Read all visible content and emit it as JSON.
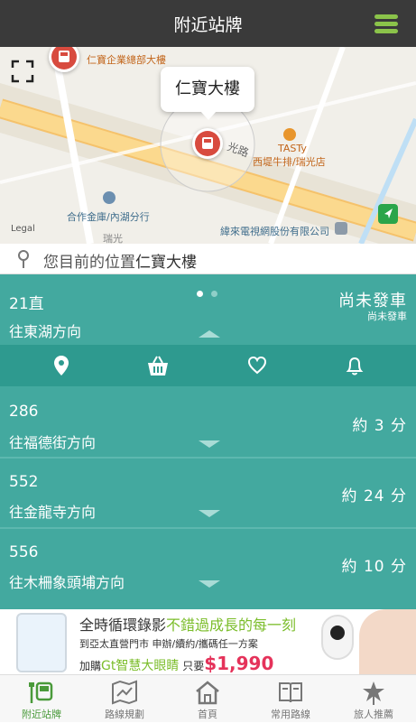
{
  "header": {
    "title": "附近站牌"
  },
  "map": {
    "labels": {
      "company": "仁寶企業總部大樓",
      "road": "光路",
      "restaurant_brand": "TASTy",
      "restaurant": "西堤牛排/瑞光店",
      "bank": "合作金庫/內湖分行",
      "cable": "緯來電視網股份有限公司",
      "road2": "瑞光",
      "legal": "Legal"
    },
    "callout": "仁寶大樓"
  },
  "location": {
    "prefix": "您目前的位置",
    "place": "仁寶大樓"
  },
  "routes": [
    {
      "number": "21直",
      "direction": "往東湖方向",
      "eta": "尚未發車",
      "eta_sub": "尚未發車",
      "expanded": true
    },
    {
      "number": "286",
      "direction": "往福德街方向",
      "eta": "約 3 分",
      "expanded": false
    },
    {
      "number": "552",
      "direction": "往金龍寺方向",
      "eta": "約 24 分",
      "expanded": false
    },
    {
      "number": "556",
      "direction": "往木柵象頭埔方向",
      "eta": "約 10 分",
      "expanded": false
    }
  ],
  "pager": {
    "count": 2,
    "active_index": 0
  },
  "actions": [
    {
      "icon": "map-pin-icon"
    },
    {
      "icon": "basket-icon"
    },
    {
      "icon": "heart-icon"
    },
    {
      "icon": "bell-icon"
    }
  ],
  "ad": {
    "headline_a": "全時循環錄影",
    "headline_b": "不錯過成長的每一刻",
    "line2": "到亞太直營門市  申辦/續約/攜碼任一方案",
    "line3_a": "加購",
    "line3_gt": "Gt智慧大眼睛",
    "line3_b": "只要",
    "price": "$1,990"
  },
  "tabs": [
    {
      "label": "附近站牌",
      "icon": "bus-stop-icon",
      "active": true
    },
    {
      "label": "路線規劃",
      "icon": "route-map-icon",
      "active": false
    },
    {
      "label": "首頁",
      "icon": "home-icon",
      "active": false
    },
    {
      "label": "常用路線",
      "icon": "book-icon",
      "active": false
    },
    {
      "label": "旅人推薦",
      "icon": "star-icon",
      "active": false
    }
  ],
  "colors": {
    "header_bg": "#3a3a3a",
    "menu_accent": "#8bc34a",
    "route_bg": "#43a99f",
    "action_bar_bg": "#2e9a8f",
    "active_tab": "#4a9a3a",
    "bus_marker": "#d84b3f"
  }
}
